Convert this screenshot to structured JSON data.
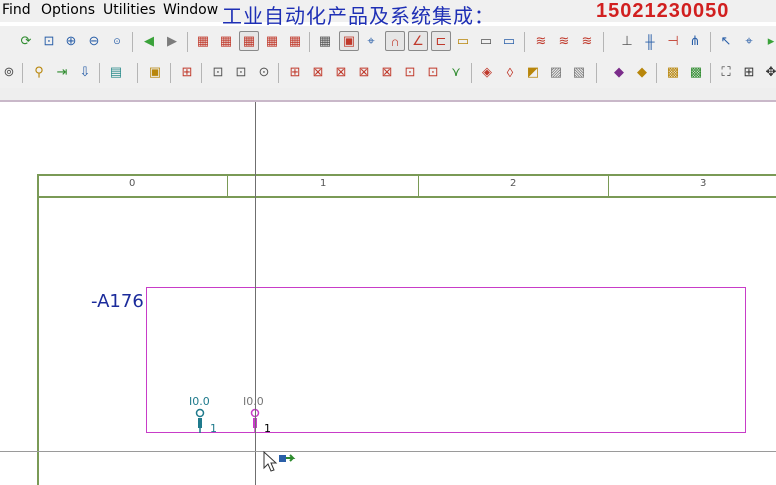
{
  "menu": {
    "find": "Find",
    "options": "Options",
    "utilities": "Utilities",
    "window": "Window"
  },
  "banner": {
    "text_cn": "工业自动化产品及系统集成：",
    "phone": "15021230050"
  },
  "grid": {
    "columns": [
      "0",
      "1",
      "2",
      "3"
    ]
  },
  "device": {
    "tag": "-A176",
    "symbols": [
      {
        "label": "I0.0",
        "pin": "1",
        "color": "#1f7a8c"
      },
      {
        "label": "I0.0",
        "pin": "1",
        "color": "#c83cc8"
      }
    ]
  },
  "colors": {
    "frame": "#7a9a56",
    "box": "#c83cc8",
    "tag": "#1b2b9b",
    "banner_cn": "#1e2fb5",
    "banner_phone": "#d11f1f"
  }
}
